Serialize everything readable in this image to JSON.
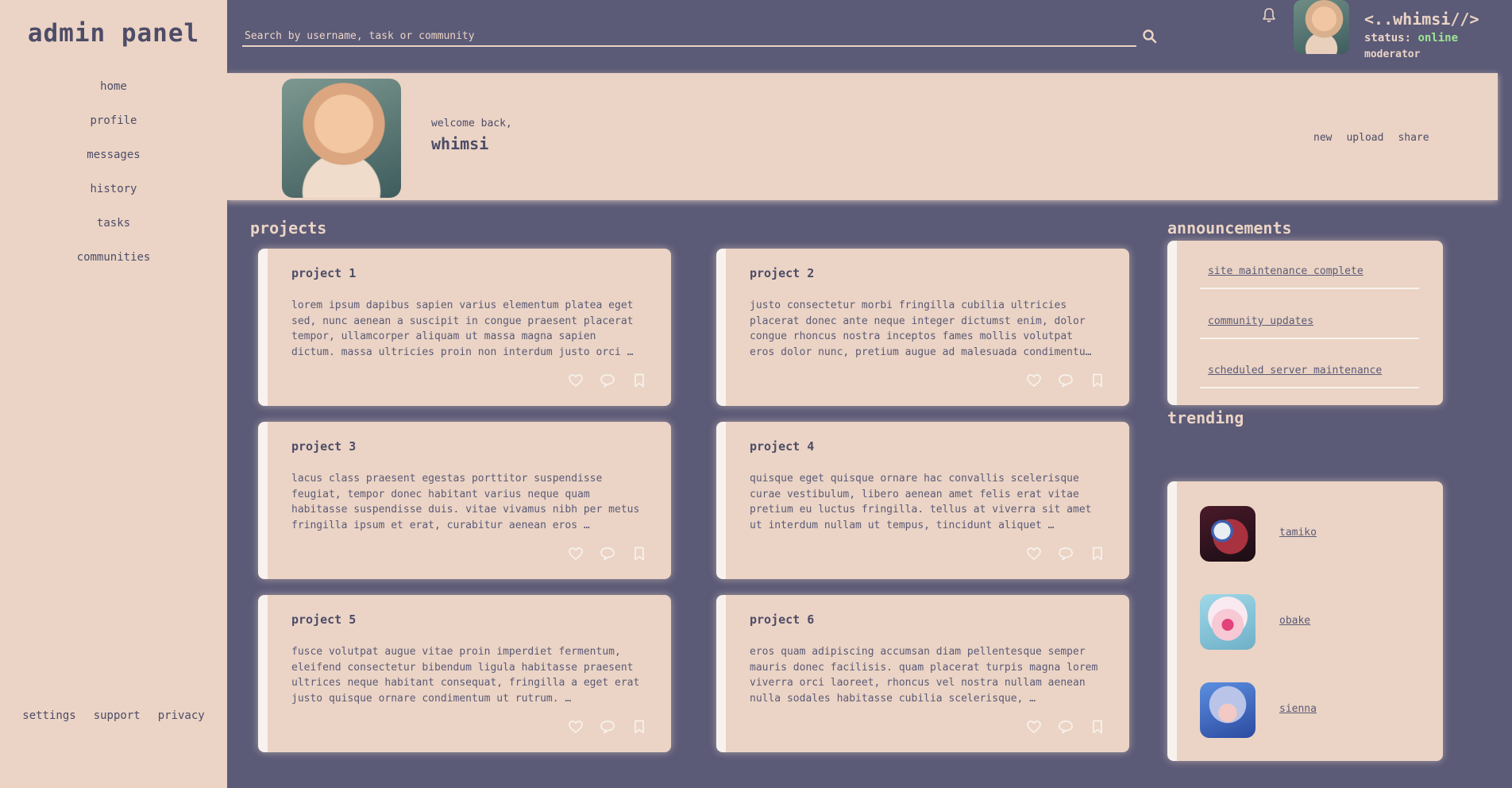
{
  "sidebar": {
    "title": "admin panel",
    "nav": [
      "home",
      "profile",
      "messages",
      "history",
      "tasks",
      "communities"
    ],
    "footer": [
      "settings",
      "support",
      "privacy"
    ]
  },
  "header": {
    "search_placeholder": "Search by username, task or community",
    "username": "<..whimsi//>",
    "status_label": "status:",
    "status_value": "online",
    "role": "moderator"
  },
  "banner": {
    "welcome": "welcome back,",
    "name": "whimsi",
    "actions": [
      "new",
      "upload",
      "share"
    ]
  },
  "sections": {
    "projects": "projects",
    "announcements": "announcements",
    "trending": "trending"
  },
  "projects": [
    {
      "title": "project 1",
      "desc": "lorem ipsum dapibus sapien varius elementum platea eget sed, nunc aenean a suscipit in congue praesent placerat tempor, ullamcorper aliquam ut massa magna sapien dictum. massa ultricies proin non interdum justo orci …"
    },
    {
      "title": "project 2",
      "desc": "justo consectetur morbi fringilla cubilia ultricies placerat donec ante neque integer dictumst enim, dolor congue rhoncus nostra inceptos fames mollis volutpat eros dolor nunc, pretium augue ad malesuada condimentu…"
    },
    {
      "title": "project 3",
      "desc": "lacus class praesent egestas porttitor suspendisse feugiat, tempor donec habitant varius neque quam habitasse suspendisse duis. vitae vivamus nibh per metus fringilla ipsum et erat, curabitur aenean eros …"
    },
    {
      "title": "project 4",
      "desc": "quisque eget quisque ornare hac convallis scelerisque curae vestibulum, libero aenean amet felis erat vitae pretium eu luctus fringilla. tellus at viverra sit amet ut interdum nullam ut tempus, tincidunt aliquet …"
    },
    {
      "title": "project 5",
      "desc": "fusce volutpat augue vitae proin imperdiet fermentum, eleifend consectetur bibendum ligula habitasse praesent ultrices neque habitant consequat, fringilla a eget erat justo quisque ornare condimentum ut rutrum. …"
    },
    {
      "title": "project 6",
      "desc": "eros quam adipiscing accumsan diam pellentesque semper mauris donec facilisis. quam placerat turpis magna lorem viverra orci laoreet, rhoncus vel nostra nullam aenean nulla sodales habitasse cubilia scelerisque, …"
    }
  ],
  "announcements": [
    "site maintenance complete",
    "community updates",
    "scheduled server maintenance"
  ],
  "trending": [
    "tamiko",
    "obake",
    "sienna"
  ],
  "colors": {
    "accent_bg": "#5b5a77",
    "panel": "#ebd4c5",
    "online": "#9ee493"
  }
}
